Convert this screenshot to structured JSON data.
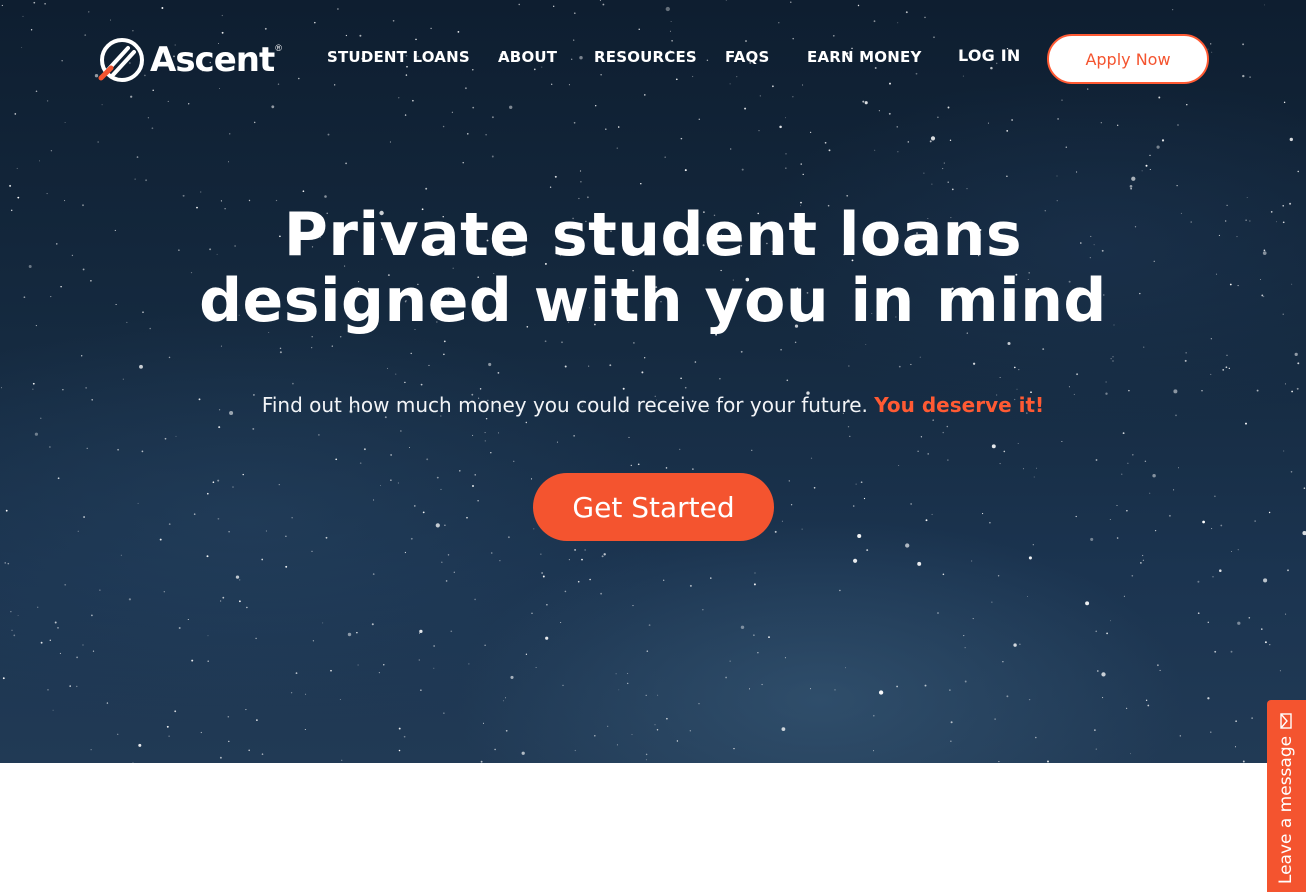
{
  "brand": {
    "name": "Ascent",
    "registered": "®"
  },
  "nav": {
    "items": [
      "STUDENT LOANS",
      "ABOUT",
      "RESOURCES",
      "FAQS",
      "EARN MONEY",
      "LOG IN"
    ],
    "apply_label": "Apply Now"
  },
  "hero": {
    "headline_line1": "Private student loans",
    "headline_line2": "designed with you in mind",
    "subline": "Find out how much money you could receive for your future.",
    "subline_accent": "You deserve it!",
    "cta_label": "Get Started"
  },
  "feedback": {
    "label": "Leave a message",
    "icon": "envelope-icon"
  },
  "colors": {
    "accent": "#f4542f",
    "hero_bg": "#132840",
    "text": "#ffffff"
  }
}
